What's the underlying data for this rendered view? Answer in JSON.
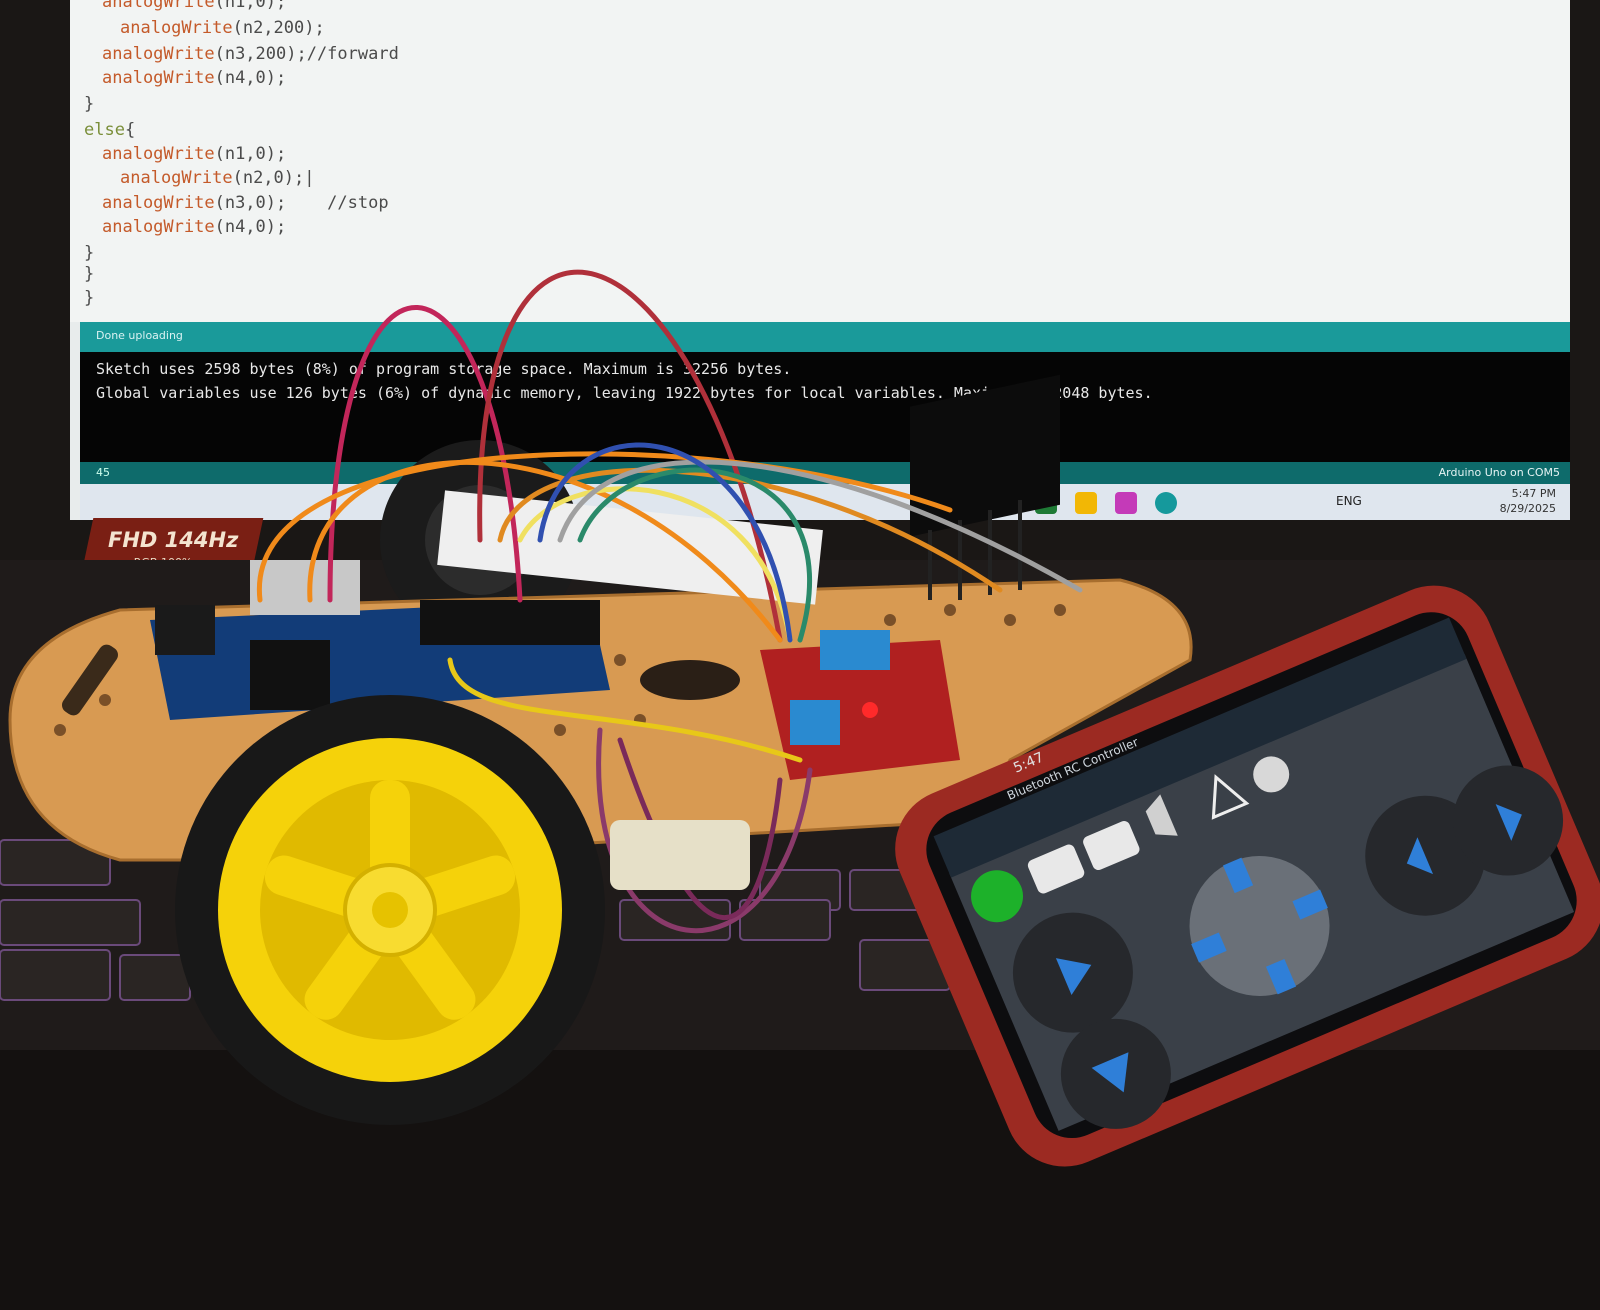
{
  "code": {
    "lines": [
      {
        "indent": 1,
        "parts": [
          {
            "t": "fn",
            "s": "analogWrite"
          },
          {
            "t": "tx",
            "s": "(n1,0);"
          }
        ]
      },
      {
        "indent": 2,
        "parts": [
          {
            "t": "fn",
            "s": "analogWrite"
          },
          {
            "t": "tx",
            "s": "(n2,200);"
          }
        ]
      },
      {
        "indent": 1,
        "parts": [
          {
            "t": "fn",
            "s": "analogWrite"
          },
          {
            "t": "tx",
            "s": "(n3,200);//forward"
          }
        ]
      },
      {
        "indent": 1,
        "parts": [
          {
            "t": "fn",
            "s": "analogWrite"
          },
          {
            "t": "tx",
            "s": "(n4,0);"
          }
        ]
      },
      {
        "indent": 0,
        "parts": [
          {
            "t": "tx",
            "s": "}"
          }
        ]
      },
      {
        "indent": 0,
        "parts": [
          {
            "t": "kw",
            "s": "else"
          },
          {
            "t": "tx",
            "s": "{"
          }
        ]
      },
      {
        "indent": 1,
        "parts": [
          {
            "t": "fn",
            "s": "analogWrite"
          },
          {
            "t": "tx",
            "s": "(n1,0);"
          }
        ]
      },
      {
        "indent": 2,
        "parts": [
          {
            "t": "fn",
            "s": "analogWrite"
          },
          {
            "t": "tx",
            "s": "(n2,0);|"
          }
        ]
      },
      {
        "indent": 1,
        "parts": [
          {
            "t": "fn",
            "s": "analogWrite"
          },
          {
            "t": "tx",
            "s": "(n3,0);    //stop"
          }
        ]
      },
      {
        "indent": 1,
        "parts": [
          {
            "t": "fn",
            "s": "analogWrite"
          },
          {
            "t": "tx",
            "s": "(n4,0);"
          }
        ]
      },
      {
        "indent": 0,
        "parts": [
          {
            "t": "tx",
            "s": "}"
          }
        ]
      },
      {
        "indent": 0,
        "parts": [
          {
            "t": "tx",
            "s": "}"
          }
        ]
      },
      {
        "indent": 0,
        "parts": [
          {
            "t": "tx",
            "s": "}"
          }
        ]
      }
    ]
  },
  "status": {
    "message": "Done uploading"
  },
  "console": {
    "line1": "Sketch uses 2598 bytes (8%) of program storage space. Maximum is 32256 bytes.",
    "line2": "Global variables use 126 bytes (6%) of dynamic memory, leaving 1922 bytes for local variables. Maximum is 2048 bytes."
  },
  "footer": {
    "line_number": "45",
    "board": "Arduino Uno on COM5"
  },
  "taskbar": {
    "language": "ENG",
    "time": "5:47 PM",
    "date": "8/29/2025"
  },
  "laptop": {
    "badge": "FHD 144Hz",
    "badge_sub": "sRGB 100%"
  },
  "phone": {
    "time": "5:47",
    "app_title": "Bluetooth RC Controller"
  },
  "colors": {
    "teal": "#1a9a9a",
    "wheel_yellow": "#f5d20a",
    "chassis": "#d8a05a",
    "phone_case": "#9c2a22",
    "board_blue": "#123c78"
  }
}
